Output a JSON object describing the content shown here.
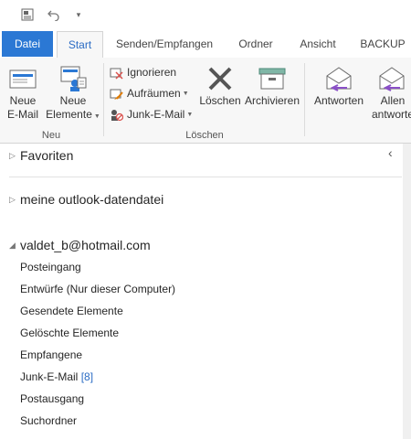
{
  "ribbon_tabs": [
    {
      "label": "Datei"
    },
    {
      "label": "Start"
    },
    {
      "label": "Senden/Empfangen"
    },
    {
      "label": "Ordner"
    },
    {
      "label": "Ansicht"
    },
    {
      "label": "BACKUP"
    }
  ],
  "groups": {
    "neu": {
      "label": "Neu",
      "new_email": "Neue\nE-Mail",
      "new_items": "Neue\nElemente"
    },
    "loeschen": {
      "label": "Löschen",
      "ignore": "Ignorieren",
      "cleanup": "Aufräumen",
      "junk": "Junk-E-Mail",
      "delete": "Löschen",
      "archive": "Archivieren"
    },
    "antworten": {
      "reply": "Antworten",
      "reply_all": "Allen\nantworte"
    }
  },
  "folder_pane": {
    "collapse_glyph": "‹",
    "favorites": "Favoriten",
    "data_file": "meine outlook-datendatei",
    "account": "valdet_b@hotmail.com",
    "folders": [
      {
        "name": "Posteingang",
        "count": ""
      },
      {
        "name": "Entwürfe (Nur dieser Computer)",
        "count": ""
      },
      {
        "name": "Gesendete Elemente",
        "count": ""
      },
      {
        "name": "Gelöschte Elemente",
        "count": ""
      },
      {
        "name": "Empfangene",
        "count": ""
      },
      {
        "name": "Junk-E-Mail",
        "count": "[8]"
      },
      {
        "name": "Postausgang",
        "count": ""
      },
      {
        "name": "Suchordner",
        "count": ""
      }
    ]
  },
  "colors": {
    "accent": "#2b78d4",
    "reply_arrow": "#8a4fc7"
  }
}
